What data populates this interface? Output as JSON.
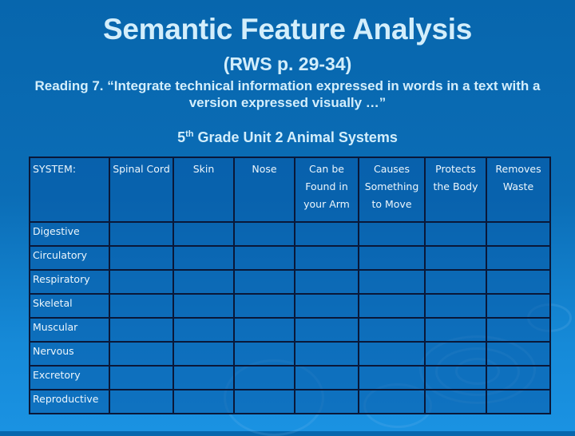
{
  "slide": {
    "title": "Semantic Feature Analysis",
    "subtitle": "(RWS p. 29-34)",
    "standard": "Reading 7. “Integrate technical information expressed in words in a text with a version expressed visually …”",
    "unit_prefix": "5",
    "unit_suffix": "th",
    "unit_rest": " Grade Unit 2 Animal Systems"
  },
  "table": {
    "corner_label": "SYSTEM:",
    "columns": [
      "Spinal Cord",
      "Skin",
      "Nose",
      "Can be Found in your Arm",
      "Causes Something to Move",
      "Protects the Body",
      "Removes Waste"
    ],
    "rows": [
      "Digestive",
      "Circulatory",
      "Respiratory",
      "Skeletal",
      "Muscular",
      "Nervous",
      "Excretory",
      "Reproductive"
    ]
  }
}
